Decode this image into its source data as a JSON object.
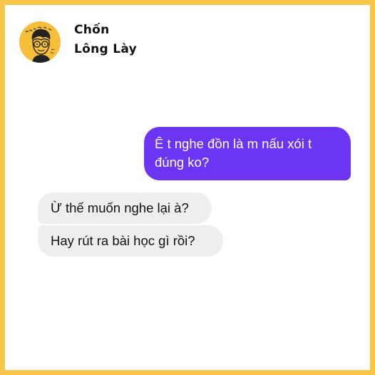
{
  "brand": {
    "name_line1": "Chốn",
    "name_line2": "Lông Lày",
    "logo_text": "Chốn Lông Lày",
    "logo_color": "#f6bf37"
  },
  "chat": {
    "messages": [
      {
        "direction": "sent",
        "text": "Ê t nghe đồn là m nấu xói t đúng ko?",
        "color": "#6c35f3"
      },
      {
        "direction": "received",
        "text": "Ừ thế muốn nghe lại à?",
        "color": "#eeeef0"
      },
      {
        "direction": "received",
        "text": "Hay rút ra bài học gì rồi?",
        "color": "#eeeef0"
      }
    ]
  },
  "frame_color": "#f7c64a"
}
